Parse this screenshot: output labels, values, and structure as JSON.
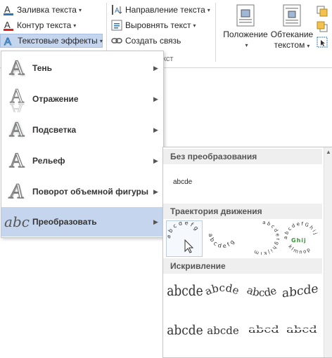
{
  "ribbon": {
    "fill_label": "Заливка текста",
    "outline_label": "Контур текста",
    "effects_label": "Текстовые эффекты",
    "direction_label": "Направление текста",
    "align_label": "Выровнять текст",
    "link_label": "Создать связь",
    "group_fragment": "кст",
    "position_label": "Положение",
    "wrap_label_1": "Обтекание",
    "wrap_label_2": "текстом"
  },
  "menu": {
    "items": [
      {
        "label": "Тень"
      },
      {
        "label": "Отражение"
      },
      {
        "label": "Подсветка"
      },
      {
        "label": "Рельеф"
      },
      {
        "label": "Поворот объемной фигуры"
      },
      {
        "label": "Преобразовать"
      }
    ],
    "transform_glyph": "abc"
  },
  "submenu": {
    "section_none": "Без преобразования",
    "plain_sample": "abcde",
    "section_path": "Траектория движения",
    "path_sample_1": "abcdefg",
    "path_sample_2": "abcdefg",
    "path_sample_3": "abcdefghijklm",
    "path_sample_4": "abcdefGhij",
    "section_warp": "Искривление",
    "warp_sample": "abcde"
  },
  "colors": {
    "fill_accent": "#2e75b6",
    "outline_accent": "#e02020",
    "effects_accent": "#2e75b6",
    "active_bg": "#c5d5ee",
    "shine_green": "#2e9e2e"
  }
}
